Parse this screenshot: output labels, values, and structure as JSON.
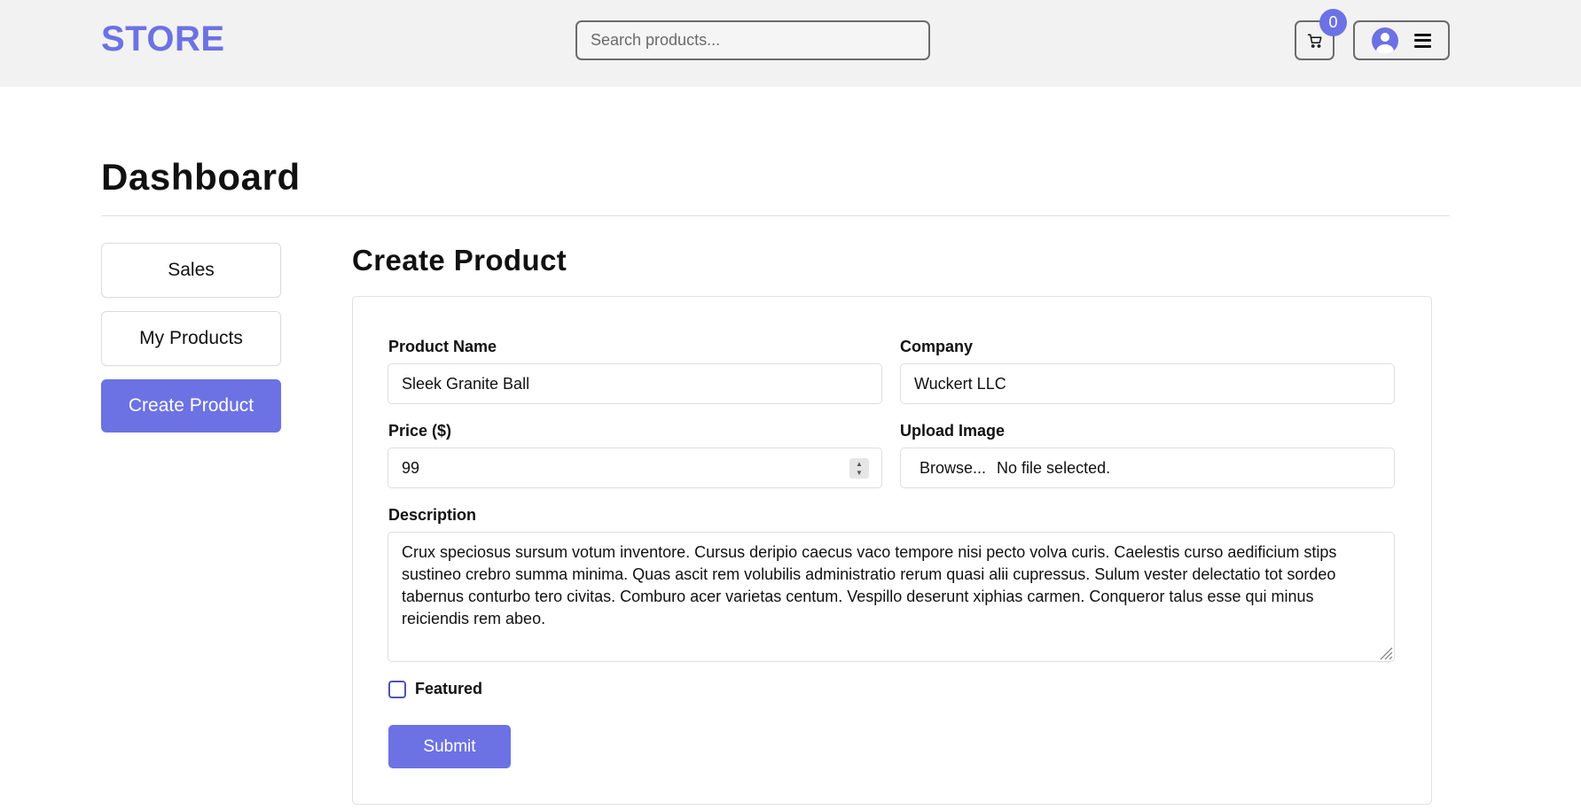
{
  "header": {
    "logo": "STORE",
    "search_placeholder": "Search products...",
    "cart_count": "0"
  },
  "page": {
    "title": "Dashboard"
  },
  "sidebar": {
    "items": [
      {
        "label": "Sales",
        "active": false
      },
      {
        "label": "My Products",
        "active": false
      },
      {
        "label": "Create Product",
        "active": true
      }
    ]
  },
  "form": {
    "title": "Create Product",
    "product_name_label": "Product Name",
    "product_name_value": "Sleek Granite Ball",
    "company_label": "Company",
    "company_value": "Wuckert LLC",
    "price_label": "Price ($)",
    "price_value": "99",
    "upload_label": "Upload Image",
    "browse_label": "Browse...",
    "file_status": "No file selected.",
    "description_label": "Description",
    "description_value": "Crux speciosus sursum votum inventore. Cursus deripio caecus vaco tempore nisi pecto volva curis. Caelestis curso aedificium stips sustineo crebro summa minima. Quas ascit rem volubilis administratio rerum quasi alii cupressus. Sulum vester delectatio tot sordeo tabernus conturbo tero civitas. Comburo acer varietas centum. Vespillo deserunt xiphias carmen. Conqueror talus esse qui minus reiciendis rem abeo.",
    "featured_label": "Featured",
    "featured_checked": false,
    "submit_label": "Submit"
  },
  "colors": {
    "accent": "#6c72e3",
    "header_bg": "#f2f2f2"
  },
  "icons": {
    "cart": "cart-icon",
    "user": "user-avatar-icon",
    "menu": "hamburger-menu-icon"
  }
}
